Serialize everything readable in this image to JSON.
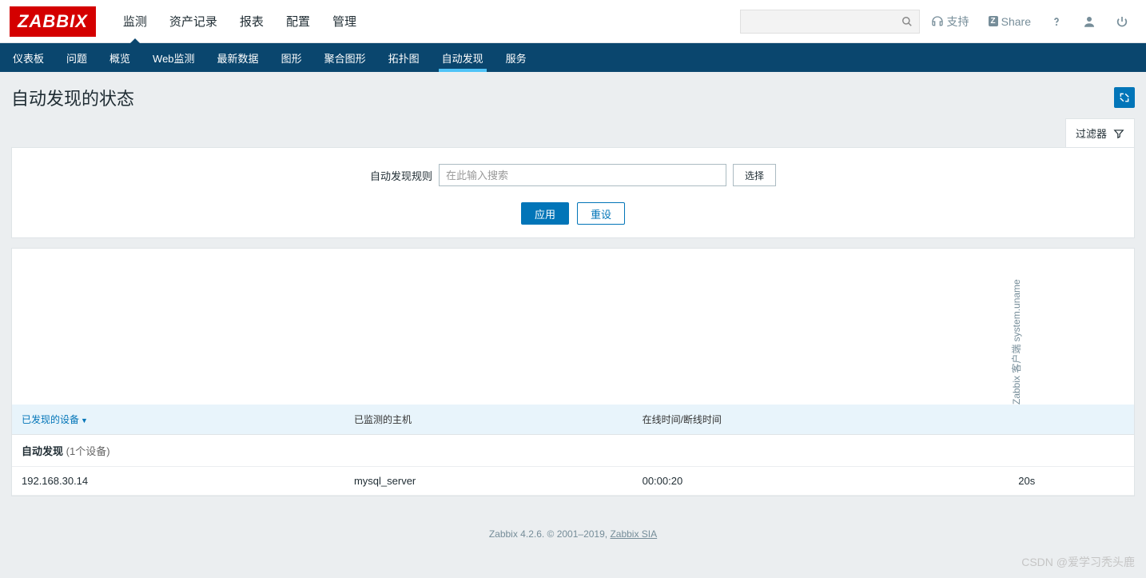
{
  "logo": "ZABBIX",
  "topNav": {
    "items": [
      "监测",
      "资产记录",
      "报表",
      "配置",
      "管理"
    ],
    "activeIndex": 0
  },
  "topRight": {
    "searchPlaceholder": "",
    "support": "支持",
    "share": "Share",
    "shareBadge": "Z"
  },
  "subNav": {
    "items": [
      "仪表板",
      "问题",
      "概览",
      "Web监测",
      "最新数据",
      "图形",
      "聚合图形",
      "拓扑图",
      "自动发现",
      "服务"
    ],
    "activeIndex": 8
  },
  "page": {
    "title": "自动发现的状态"
  },
  "filter": {
    "tabLabel": "过滤器",
    "ruleLabel": "自动发现规则",
    "rulePlaceholder": "在此输入搜索",
    "ruleValue": "",
    "selectBtn": "选择",
    "applyBtn": "应用",
    "resetBtn": "重设"
  },
  "table": {
    "rotatedHeader": "Zabbix 客户端 system.uname",
    "columns": {
      "device": "已发现的设备",
      "host": "已监测的主机",
      "uptime": "在线时间/断线时间"
    },
    "groupLabel": "自动发现",
    "groupCount": "(1个设备)",
    "rows": [
      {
        "device": "192.168.30.14",
        "host": "mysql_server",
        "uptime": "00:00:20",
        "check": "20s"
      }
    ]
  },
  "footer": {
    "text": "Zabbix 4.2.6. © 2001–2019, ",
    "linkText": "Zabbix SIA"
  },
  "watermark": "CSDN @爱学习秃头鹿"
}
